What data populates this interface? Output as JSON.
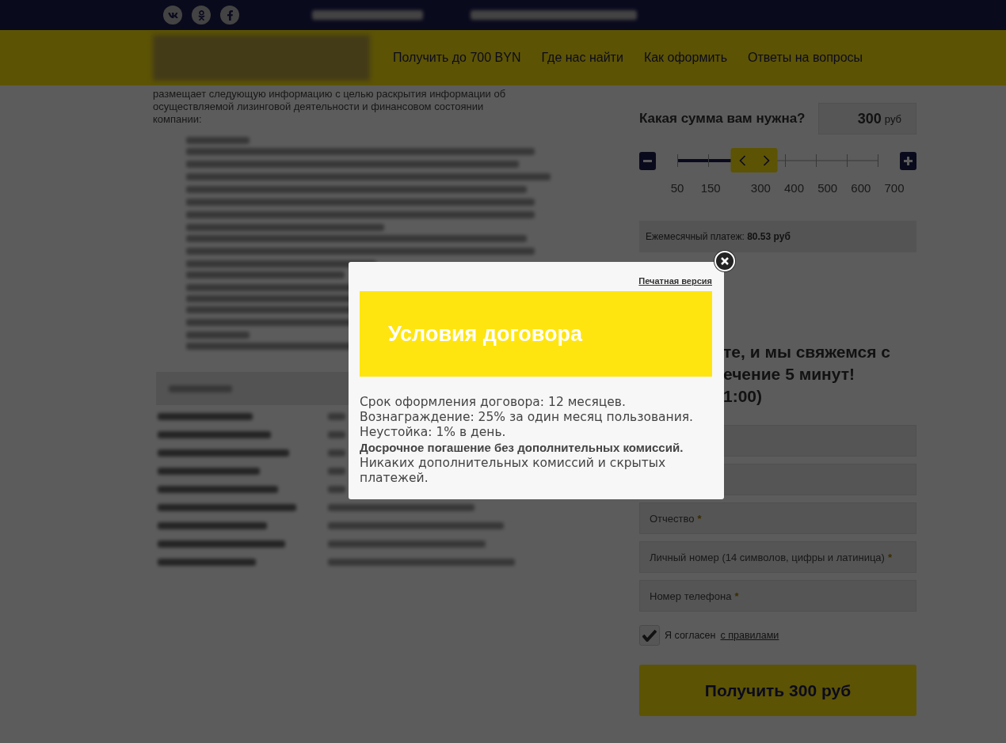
{
  "nav": {
    "items": [
      "Получить до 700 BYN",
      "Где нас найти",
      "Как оформить",
      "Ответы на вопросы"
    ]
  },
  "intro_text": "размещает следующую информацию с целью раскрытия информации об осуществляемой лизинговой деятельности и финансовом состоянии компании:",
  "calculator": {
    "question": "Какая сумма вам нужна?",
    "amount": "300",
    "currency": "руб",
    "slider": {
      "level": 0.385,
      "tick_labels": [
        "50",
        "150",
        "300",
        "400",
        "500",
        "600",
        "700"
      ]
    },
    "monthly_payment": "Ежемесячный платеж: **80.53 руб**"
  },
  "form": {
    "heading_lines": [
      "те, и мы свяжемся с",
      "ечение 5 минут!",
      "1:00)"
    ],
    "fields": [
      {
        "kind": "covered"
      },
      {
        "kind": "covered"
      },
      {
        "kind": "text",
        "placeholder": "Отчество",
        "required_mark": "*"
      },
      {
        "kind": "text",
        "placeholder": "Личный номер (14 символов, цифры и латиница)",
        "required_mark": "*"
      },
      {
        "kind": "text",
        "placeholder": "Номер телефона",
        "required_mark": "*"
      }
    ],
    "agreement": {
      "checked": true,
      "label": "Я согласен",
      "link": "с правилами"
    },
    "submit": "Получить 300 руб"
  },
  "modal": {
    "print_link": "Печатная версия",
    "title": "Условия договора",
    "lines": [
      "Срок оформления договора: 12 месяцев.",
      "Вознаграждение: 25% за один месяц пользования.",
      "Неустойка: 1% в день.",
      "**Досрочное погашение без дополнительных комиссий.**",
      "Никаких дополнительных комиссий и скрытых платежей."
    ]
  }
}
